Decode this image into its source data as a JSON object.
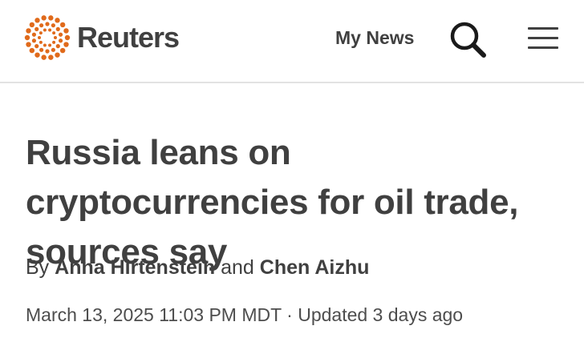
{
  "header": {
    "logo_text": "Reuters",
    "brand_color": "#e06a1b",
    "my_news_label": "My News",
    "search_icon": "search-icon",
    "menu_icon": "hamburger-menu-icon"
  },
  "article": {
    "headline": "Russia leans on cryptocurrencies for oil trade, sources say",
    "byline": {
      "prefix": "By",
      "author_1": "Anna Hirtenstein",
      "conjunction": "and",
      "author_2": "Chen Aizhu"
    },
    "published": "March 13, 2025 11:03 PM MDT",
    "separator": "·",
    "updated": "Updated 3 days ago"
  }
}
